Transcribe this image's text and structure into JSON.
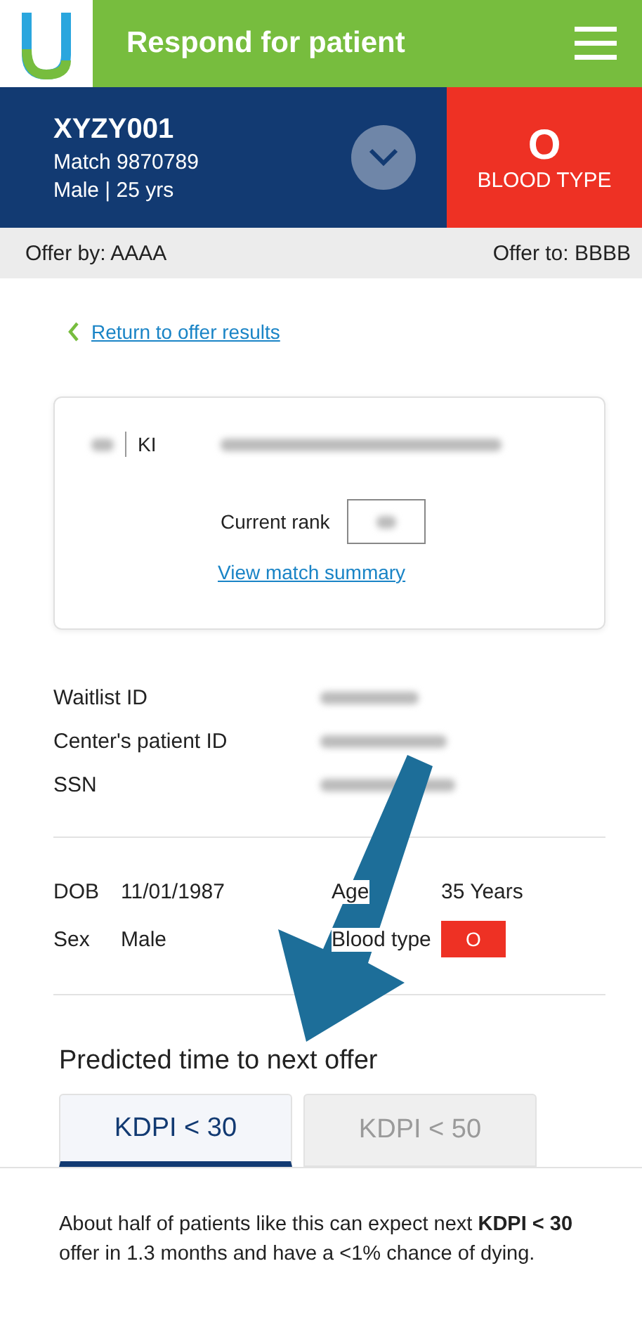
{
  "app_bar": {
    "title": "Respond for patient"
  },
  "patient": {
    "id": "XYZY001",
    "match": "Match 9870789",
    "summary": "Male | 25 yrs",
    "blood_type": "O",
    "blood_type_label": "BLOOD TYPE",
    "expanded": false
  },
  "offer_strip": {
    "offer_by": "Offer by: AAAA",
    "offer_to": "Offer to: BBBB"
  },
  "back_link": "Return to offer results",
  "match_card": {
    "organ": "KI",
    "rank_label": "Current rank",
    "summary_link": "View match summary"
  },
  "identifiers": [
    {
      "label": "Waitlist ID"
    },
    {
      "label": "Center's patient ID"
    },
    {
      "label": "SSN"
    }
  ],
  "demographics": [
    {
      "label": "DOB",
      "value": "11/01/1987",
      "kind": "text"
    },
    {
      "label": "Age",
      "value": "35 Years",
      "kind": "text"
    },
    {
      "label": "Sex",
      "value": "Male",
      "kind": "text"
    },
    {
      "label": "Blood type",
      "value": "O",
      "kind": "badge"
    }
  ],
  "prediction": {
    "heading": "Predicted time to next offer",
    "tabs": [
      {
        "label": "KDPI < 30",
        "selected": true
      },
      {
        "label": "KDPI < 50",
        "selected": false
      }
    ],
    "text": "About half of patients like this can expect next **KDPI < 30** offer in 1.3 months and have a <1% chance of dying."
  }
}
